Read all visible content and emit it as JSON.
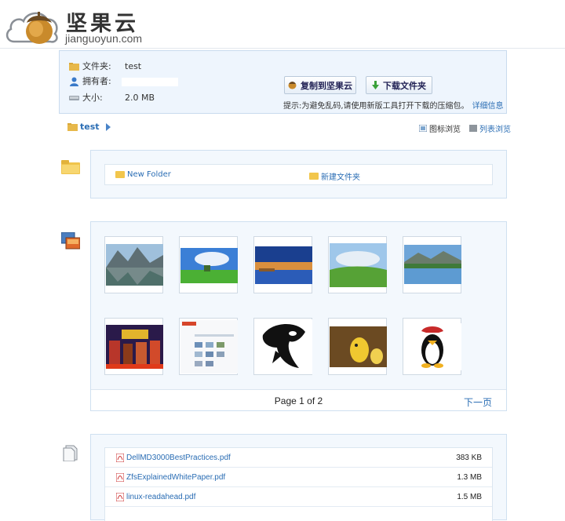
{
  "header": {
    "logo_cn": "坚果云",
    "logo_en": "jianguoyun.com"
  },
  "info": {
    "folder_label": "文件夹:",
    "folder_value": "test",
    "owner_label": "拥有者:",
    "size_label": "大小:",
    "size_value": "2.0 MB",
    "copy_button": "复制到坚果云",
    "download_button": "下载文件夹",
    "tip": "提示:为避免乱码,请使用新版工具打开下载的压缩包。",
    "tip_link": "详细信息"
  },
  "breadcrumb": {
    "folder": "test"
  },
  "view_options": {
    "icon_view": "图标浏览",
    "list_view": "列表浏览"
  },
  "folders": [
    {
      "name": "New Folder"
    },
    {
      "name": "新建文件夹"
    }
  ],
  "gallery": {
    "pager_text": "Page 1 of 2",
    "next_label": "下一页"
  },
  "files": [
    {
      "name": "DellMD3000BestPractices.pdf",
      "size": "383 KB"
    },
    {
      "name": "ZfsExplainedWhitePaper.pdf",
      "size": "1.3 MB"
    },
    {
      "name": "linux-readahead.pdf",
      "size": "1.5 MB"
    }
  ],
  "colors": {
    "link": "#2a6db4",
    "panel_bg": "#eef5fd",
    "panel_border": "#c9dbee"
  }
}
